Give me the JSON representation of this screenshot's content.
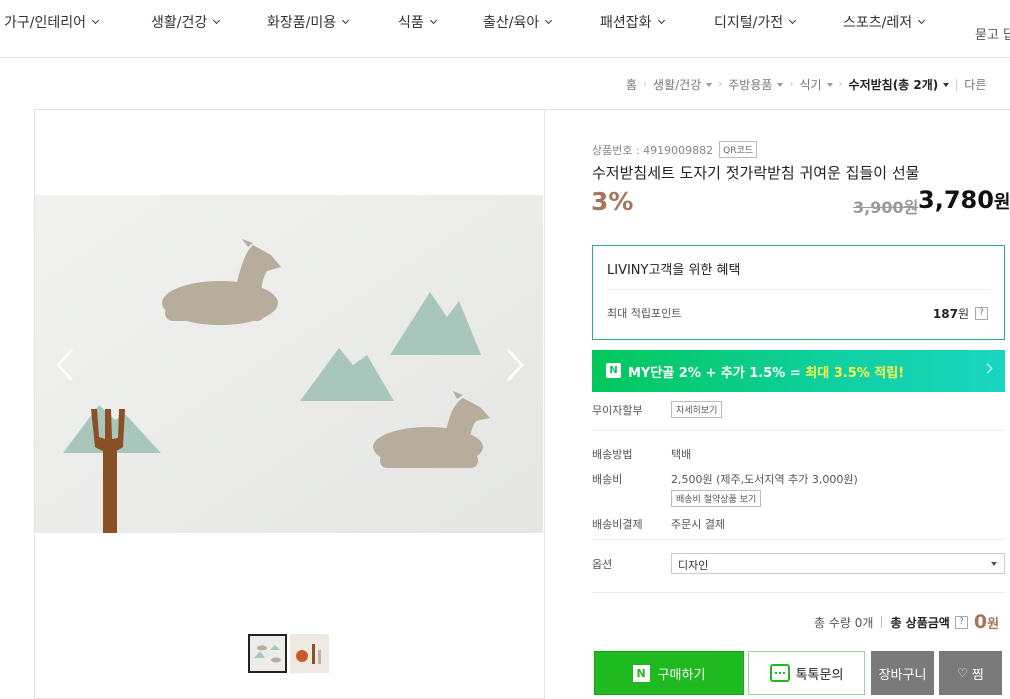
{
  "nav": {
    "categories": [
      "가구/인테리어",
      "생활/건강",
      "화장품/미용",
      "식품",
      "출산/육아",
      "패션잡화",
      "디지털/가전",
      "스포츠/레저"
    ],
    "qa_label": "묻고 답"
  },
  "breadcrumb": {
    "home": "홈",
    "items": [
      "생활/건강",
      "주방용품",
      "식기"
    ],
    "current": "수저받침(총 2개)",
    "other": "다른"
  },
  "product": {
    "number_label": "상품번호 : 4919009882",
    "qr_label": "QR코드",
    "title": "수저받침세트 도자기 젓가락받침 귀여운 집들이 선물",
    "discount": "3%",
    "original_price": "3,900원",
    "sale_price_value": "3,780",
    "sale_price_unit": "원"
  },
  "benefit": {
    "title": "LIVINY고객을 위한 혜택",
    "point_label": "최대 적립포인트",
    "point_value": "187",
    "point_unit": "원",
    "help": "?"
  },
  "npay": {
    "logo": "N",
    "text_main": "MY단골 2% + 추가 1.5% = ",
    "text_highlight": "최대 3.5% 적립!"
  },
  "details": {
    "installment_label": "무이자할부",
    "installment_button": "자세히보기",
    "shipping_method_label": "배송방법",
    "shipping_method_value": "택배",
    "shipping_fee_label": "배송비",
    "shipping_fee_value": "2,500원 (제주,도서지역 추가 3,000원)",
    "shipping_fee_button": "배송비 절약상품 보기",
    "shipping_pay_label": "배송비결제",
    "shipping_pay_value": "주문시 결제"
  },
  "option": {
    "label": "옵션",
    "selected": "디자인"
  },
  "totals": {
    "qty_label": "총 수량 0개",
    "total_label": "총 상품금액",
    "help": "?",
    "total_value": "0",
    "total_unit": "원"
  },
  "actions": {
    "buy": "구매하기",
    "buy_logo": "N",
    "talk": "톡톡문의",
    "cart": "장바구니",
    "zzim": "찜"
  },
  "colors": {
    "accent_teal": "#2aa6a0",
    "npay_green": "#03c75a",
    "buy_green": "#1fba20",
    "discount_brown": "#a5765a"
  }
}
